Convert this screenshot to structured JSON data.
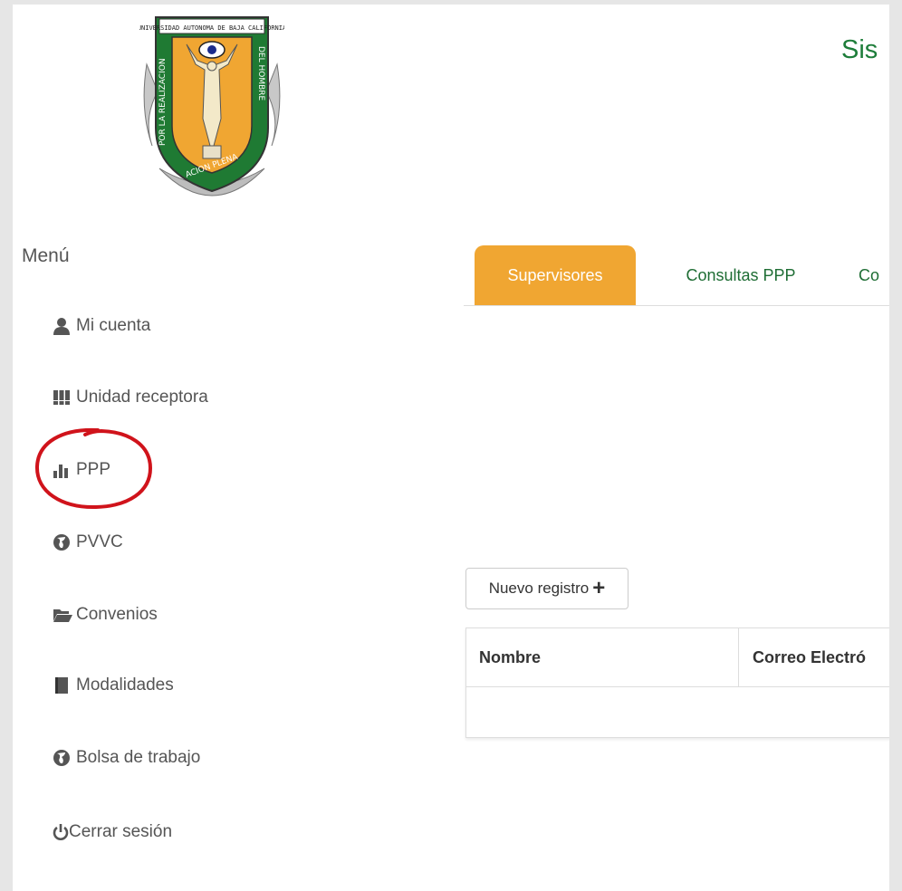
{
  "header": {
    "title": "Sis",
    "logo_text": "POR LA REALIZACION PLENA DEL HOMBRE"
  },
  "sidebar": {
    "heading": "Menú",
    "items": [
      {
        "label": "Mi cuenta",
        "icon": "user-icon"
      },
      {
        "label": "Unidad receptora",
        "icon": "th-icon"
      },
      {
        "label": "PPP",
        "icon": "bar-chart-icon"
      },
      {
        "label": "PVVC",
        "icon": "globe-icon"
      },
      {
        "label": "Convenios",
        "icon": "folder-open-icon"
      },
      {
        "label": "Modalidades",
        "icon": "book-icon"
      },
      {
        "label": "Bolsa de trabajo",
        "icon": "globe-icon"
      },
      {
        "label": "Cerrar sesión",
        "icon": "power-icon"
      }
    ]
  },
  "tabs": [
    {
      "label": "Supervisores",
      "active": true
    },
    {
      "label": "Consultas PPP",
      "active": false
    },
    {
      "label": "Co",
      "active": false
    }
  ],
  "toolbar": {
    "new_record_label": "Nuevo registro"
  },
  "table": {
    "columns": [
      "Nombre",
      "Correo Electró"
    ],
    "rows": []
  },
  "colors": {
    "accent": "#f0a632",
    "brand_green": "#1e7d3a",
    "text": "#555555",
    "annotation": "#d0131b"
  }
}
